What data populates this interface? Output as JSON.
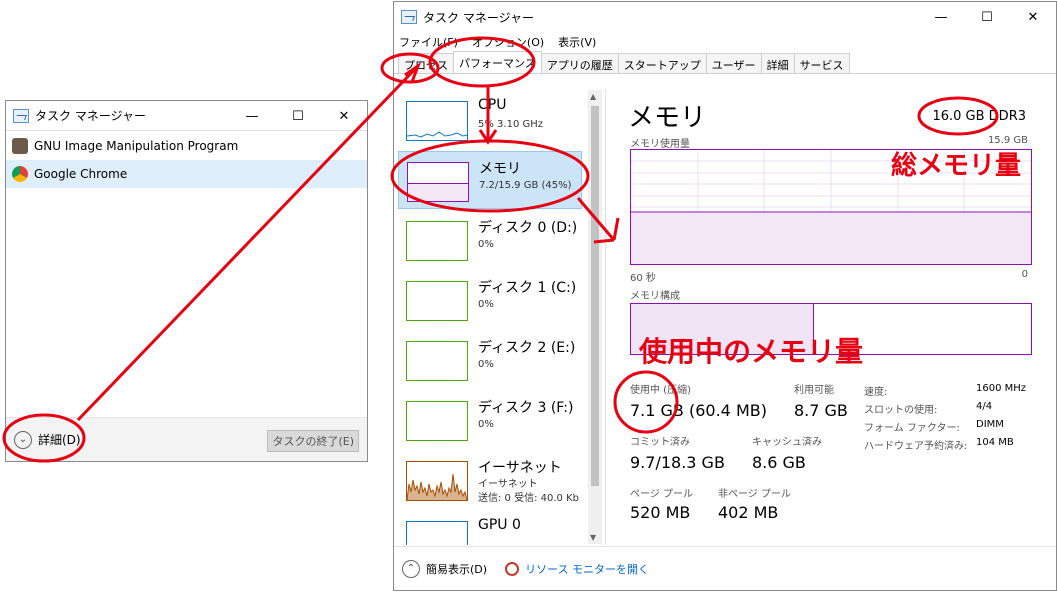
{
  "small_window": {
    "title": "タスク マネージャー",
    "apps": [
      {
        "name": "GNU Image Manipulation Program"
      },
      {
        "name": "Google Chrome"
      }
    ],
    "details_label": "詳細(D)",
    "end_task_label": "タスクの終了(E)"
  },
  "big_window": {
    "title": "タスク マネージャー",
    "menu": [
      "ファイル(F)",
      "オプション(O)",
      "表示(V)"
    ],
    "tabs": [
      "プロセス",
      "パフォーマンス",
      "アプリの履歴",
      "スタートアップ",
      "ユーザー",
      "詳細",
      "サービス"
    ],
    "side_items": [
      {
        "title": "CPU",
        "sub": "5% 3.10 GHz",
        "sub2": ""
      },
      {
        "title": "メモリ",
        "sub": "7.2/15.9 GB (45%)",
        "sub2": ""
      },
      {
        "title": "ディスク 0 (D:)",
        "sub": "0%",
        "sub2": ""
      },
      {
        "title": "ディスク 1 (C:)",
        "sub": "0%",
        "sub2": ""
      },
      {
        "title": "ディスク 2 (E:)",
        "sub": "0%",
        "sub2": ""
      },
      {
        "title": "ディスク 3 (F:)",
        "sub": "0%",
        "sub2": ""
      },
      {
        "title": "イーサネット",
        "sub": "イーサネット",
        "sub2": "送信: 0 受信: 40.0 Kb"
      },
      {
        "title": "GPU 0",
        "sub": "",
        "sub2": ""
      }
    ],
    "memory": {
      "heading": "メモリ",
      "total": "16.0 GB DDR3",
      "usage_label": "メモリ使用量",
      "usage_max": "15.9 GB",
      "axis_left": "60 秒",
      "axis_right": "0",
      "composition_label": "メモリ構成",
      "in_use_label": "使用中 (圧縮)",
      "in_use_value": "7.1 GB (60.4 MB)",
      "available_label": "利用可能",
      "available_value": "8.7 GB",
      "committed_label": "コミット済み",
      "committed_value": "9.7/18.3 GB",
      "cached_label": "キャッシュ済み",
      "cached_value": "8.6 GB",
      "paged_label": "ページ プール",
      "paged_value": "520 MB",
      "nonpaged_label": "非ページ プール",
      "nonpaged_value": "402 MB",
      "stats": [
        {
          "k": "速度:",
          "v": "1600 MHz"
        },
        {
          "k": "スロットの使用:",
          "v": "4/4"
        },
        {
          "k": "フォーム ファクター:",
          "v": "DIMM"
        },
        {
          "k": "ハードウェア予約済み:",
          "v": "104 MB"
        }
      ]
    },
    "footer": {
      "fewer_details": "簡易表示(D)",
      "resource_monitor": "リソース モニターを開く"
    }
  },
  "annotations": {
    "total_memory": "総メモリ量",
    "memory_in_use": "使用中のメモリ量"
  },
  "colors": {
    "annotation_red": "#e60012",
    "memory_purple": "#8b12ae",
    "disk_green": "#4da60c",
    "cpu_blue": "#1178be",
    "net_brown": "#a74f01"
  }
}
